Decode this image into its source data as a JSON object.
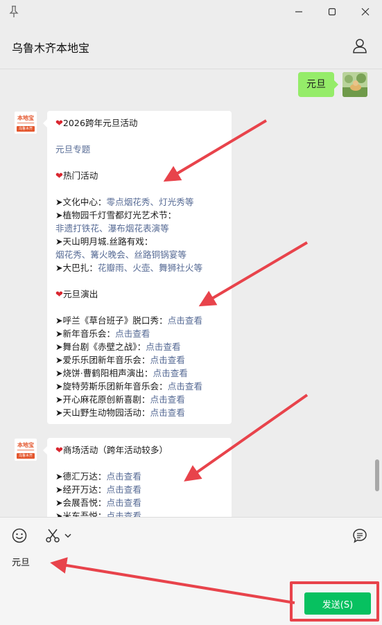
{
  "window": {
    "pin_icon": "pin-icon",
    "minimize_icon": "minimize-icon",
    "maximize_icon": "maximize-icon",
    "close_icon": "close-icon"
  },
  "header": {
    "title": "乌鲁木齐本地宝",
    "profile_icon": "person-icon"
  },
  "chat": {
    "my_message": "元旦",
    "bot_avatar": {
      "top": "本地宝",
      "bottom": "乌鲁木齐"
    },
    "message1": {
      "title": "2026跨年元旦活动",
      "special_link": "元旦专题",
      "hot_heading": "热门活动",
      "hot": [
        {
          "prefix": "➤文化中心：",
          "link": "零点烟花秀、灯光秀等"
        },
        {
          "prefix": "➤植物园千灯雪都灯光艺术节：",
          "link": ""
        },
        {
          "prefix": "",
          "link": "非遗打铁花、瀑布烟花表演等"
        },
        {
          "prefix": "➤天山明月城.丝路有戏：",
          "link": ""
        },
        {
          "prefix": "",
          "link": "烟花秀、篝火晚会、丝路铜锅宴等"
        },
        {
          "prefix": "➤大巴扎：",
          "link": "花瓣雨、火壶、舞狮社火等"
        }
      ],
      "show_heading": "元旦演出",
      "shows": [
        {
          "prefix": "➤呼兰《草台班子》脱口秀：",
          "link": "点击查看"
        },
        {
          "prefix": "➤新年音乐会：",
          "link": "点击查看"
        },
        {
          "prefix": "➤舞台剧《赤壁之战》：",
          "link": "点击查看"
        },
        {
          "prefix": "➤爱乐乐团新年音乐会：",
          "link": "点击查看"
        },
        {
          "prefix": "➤烧饼·曹鹤阳相声演出：",
          "link": "点击查看"
        },
        {
          "prefix": "➤旋特劳斯乐团新年音乐会：",
          "link": "点击查看"
        },
        {
          "prefix": "➤开心麻花原创新喜剧：",
          "link": "点击查看"
        },
        {
          "prefix": "➤天山野生动物园活动：",
          "link": "点击查看"
        }
      ]
    },
    "message2": {
      "title": "商场活动（跨年活动较多）",
      "items": [
        {
          "prefix": "➤德汇万达：",
          "link": "点击查看"
        },
        {
          "prefix": "➤经开万达：",
          "link": "点击查看"
        },
        {
          "prefix": "➤会展吾悦：",
          "link": "点击查看"
        },
        {
          "prefix": "➤米东吾悦：",
          "link": "点击查看"
        }
      ]
    }
  },
  "input": {
    "emoji_icon": "emoji-icon",
    "scissors_icon": "scissors-icon",
    "chevron_icon": "chevron-down-icon",
    "history_icon": "chat-history-icon",
    "text": "元旦",
    "send_label": "发送(S)"
  },
  "colors": {
    "my_bubble": "#95ec69",
    "send_button": "#07c160",
    "link": "#576b95",
    "annotation": "#e8434b"
  }
}
